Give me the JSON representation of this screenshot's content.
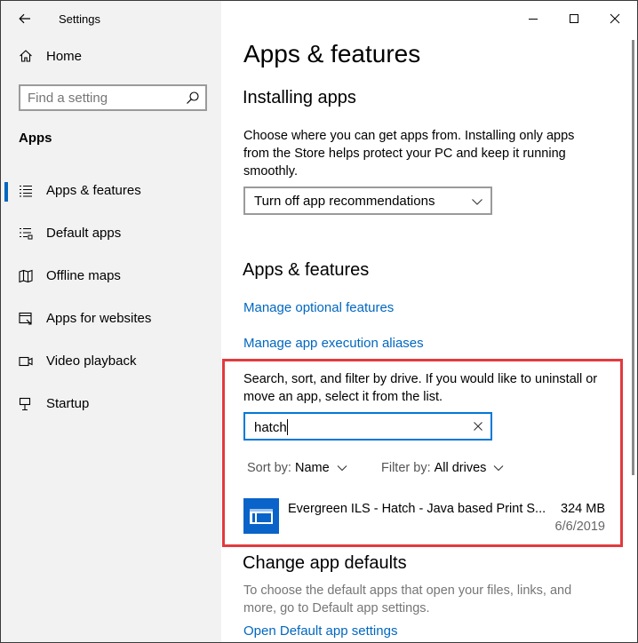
{
  "window": {
    "app_title": "Settings"
  },
  "sidebar": {
    "home_label": "Home",
    "search_placeholder": "Find a setting",
    "section_label": "Apps",
    "items": [
      {
        "label": "Apps & features",
        "icon": "list-icon",
        "selected": true
      },
      {
        "label": "Default apps",
        "icon": "default-apps-icon",
        "selected": false
      },
      {
        "label": "Offline maps",
        "icon": "map-icon",
        "selected": false
      },
      {
        "label": "Apps for websites",
        "icon": "link-icon",
        "selected": false
      },
      {
        "label": "Video playback",
        "icon": "video-icon",
        "selected": false
      },
      {
        "label": "Startup",
        "icon": "startup-icon",
        "selected": false
      }
    ]
  },
  "main": {
    "page_title": "Apps & features",
    "installing": {
      "heading": "Installing apps",
      "description": "Choose where you can get apps from. Installing only apps from the Store helps protect your PC and keep it running smoothly.",
      "dropdown_value": "Turn off app recommendations"
    },
    "features": {
      "heading": "Apps & features",
      "link_optional": "Manage optional features",
      "link_aliases": "Manage app execution aliases",
      "description": "Search, sort, and filter by drive. If you would like to uninstall or move an app, select it from the list.",
      "search_value": "hatch",
      "sort_label": "Sort by:",
      "sort_value": "Name",
      "filter_label": "Filter by:",
      "filter_value": "All drives"
    },
    "apps": [
      {
        "name": "Evergreen ILS - Hatch - Java based Print S...",
        "size": "324 MB",
        "date": "6/6/2019"
      }
    ],
    "defaults": {
      "heading": "Change app defaults",
      "description": "To choose the default apps that open your files, links, and more, go to Default app settings.",
      "link": "Open Default app settings"
    }
  },
  "colors": {
    "accent": "#0067c0",
    "highlight_border": "#e23a3e",
    "sidebar_bg": "#f2f2f2",
    "app_icon_bg": "#0a63c9"
  }
}
